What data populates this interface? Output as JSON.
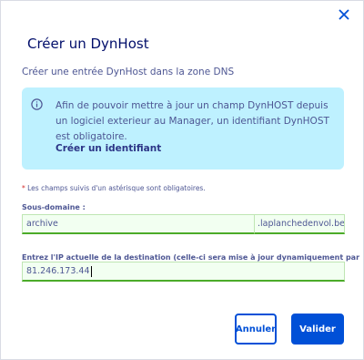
{
  "dialog": {
    "title": "Créer un DynHost",
    "subtitle": "Créer une entrée DynHost dans la zone DNS",
    "close_icon": "close-icon"
  },
  "info": {
    "icon": "info-icon",
    "text": "Afin de pouvoir mettre à jour un champ DynHOST depuis un logiciel exterieur au Manager, un identifiant DynHOST est obligatoire.",
    "link_label": "Créer un identifiant"
  },
  "form": {
    "required_note_star": "*",
    "required_note": "Les champs suivis d'un astérisque sont obligatoires.",
    "subdomain": {
      "label": "Sous-domaine :",
      "value": "archive",
      "suffix": ".laplanchedenvol.be"
    },
    "ip": {
      "label": "Entrez l'IP actuelle de la destination (celle-ci sera mise à jour dynamiquement par la suite):  *",
      "value": "81.246.173.44"
    }
  },
  "buttons": {
    "cancel_label": "Annuler",
    "submit_label": "Valider"
  },
  "colors": {
    "primary": "#0050d7",
    "title": "#000d6a",
    "text": "#4d5693",
    "info_bg": "#bef1ff",
    "valid_border": "#4cab29",
    "valid_bg": "#f2fff1"
  }
}
